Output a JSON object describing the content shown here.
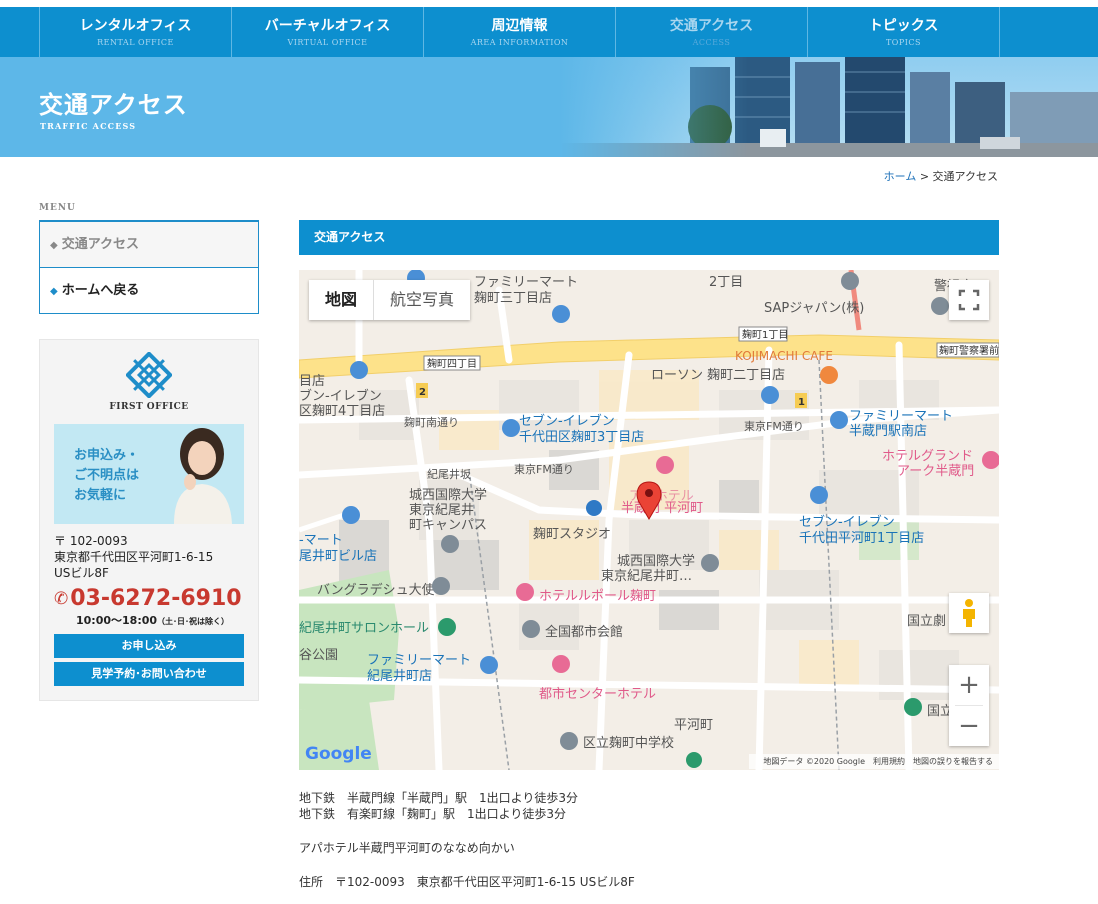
{
  "nav": [
    {
      "ja": "レンタルオフィス",
      "en": "RENTAL OFFICE"
    },
    {
      "ja": "バーチャルオフィス",
      "en": "VIRTUAL OFFICE"
    },
    {
      "ja": "周辺情報",
      "en": "AREA INFORMATION"
    },
    {
      "ja": "交通アクセス",
      "en": "ACCESS"
    },
    {
      "ja": "トピックス",
      "en": "TOPICS"
    }
  ],
  "hero": {
    "title": "交通アクセス",
    "subtitle": "TRAFFIC ACCESS"
  },
  "breadcrumb": {
    "home": "ホーム",
    "sep": " > ",
    "current": "交通アクセス"
  },
  "sidebar": {
    "menu_label": "MENU",
    "items": [
      {
        "label": "交通アクセス"
      },
      {
        "label": "ホームへ戻る"
      }
    ],
    "logo_text": "FIRST OFFICE",
    "promo": {
      "line1": "お申込み・",
      "line2": "ご不明点は",
      "line3": "お気軽に"
    },
    "address": {
      "zip": "〒 102-0093",
      "line1": "東京都千代田区平河町1-6-15",
      "line2": "USビル8F"
    },
    "phone": "03-6272-6910",
    "hours": "10:00〜18:00",
    "hours_note": "（土･日･祝は除く）",
    "apply_button": "お申し込み",
    "contact_button": "見学予約･お問い合わせ"
  },
  "content": {
    "heading": "交通アクセス",
    "map": {
      "tab_map": "地図",
      "tab_satellite": "航空写真",
      "google": "Google",
      "attr_data": "地図データ ©2020 Google",
      "attr_terms": "利用規約",
      "attr_report": "地図の誤りを報告する",
      "labels": {
        "l1": "ファミリーマート",
        "l2": "麹町三丁目店",
        "l3": "2丁目",
        "l4": "SAPジャパン(株)",
        "l5": "警視庁",
        "l6": "麹町1丁目",
        "l7": "麹町四丁目",
        "l8": "KOJIMACHI CAFE",
        "l9": "麹町警察署前",
        "l10": "ローソン 麹町二丁目店",
        "l11": "麹町南通り",
        "l12": "ブン-イレブン",
        "l13": "区麹町4丁目店",
        "l14": "目店",
        "l15": "セブン-イレブン",
        "l16": "千代田区麹町3丁目店",
        "l17": "東京FM通り",
        "l18": "ファミリーマート",
        "l19": "半蔵門駅南店",
        "l20": "紀尾井坂",
        "l21": "東京FM通り",
        "l22": "ホテルグランド",
        "l23": "アーク半蔵門",
        "l24": "城西国際大学",
        "l25": "東京紀尾井",
        "l26": "町キャンパス",
        "l27": "アパホテル",
        "l28": "半蔵門 平河町",
        "l29": "麹町スタジオ",
        "l30": "セブン-イレブン",
        "l31": "千代田平河町1丁目店",
        "l32": "-マート",
        "l33": "尾井町ビル店",
        "l34": "城西国際大学",
        "l35": "東京紀尾井町…",
        "l36": "バングラデシュ大使",
        "l37": "ホテルルポール麹町",
        "l38": "国立劇",
        "l39": "紀尾井町サロンホール",
        "l40": "全国都市会館",
        "l41": "谷公園",
        "l42": "ファミリーマート",
        "l43": "紀尾井町店",
        "l44": "都市センターホテル",
        "l45": "平河町",
        "l46": "区立麹町中学校",
        "l47": "国立"
      }
    },
    "access1": "地下鉄　半蔵門線「半蔵門」駅　1出口より徒歩3分",
    "access2": "地下鉄　有楽町線「麹町」駅　1出口より徒歩3分",
    "landmark": "アパホテル半蔵門平河町のななめ向かい",
    "address": "住所　〒102-0093　東京都千代田区平河町1-6-15 USビル8F"
  }
}
